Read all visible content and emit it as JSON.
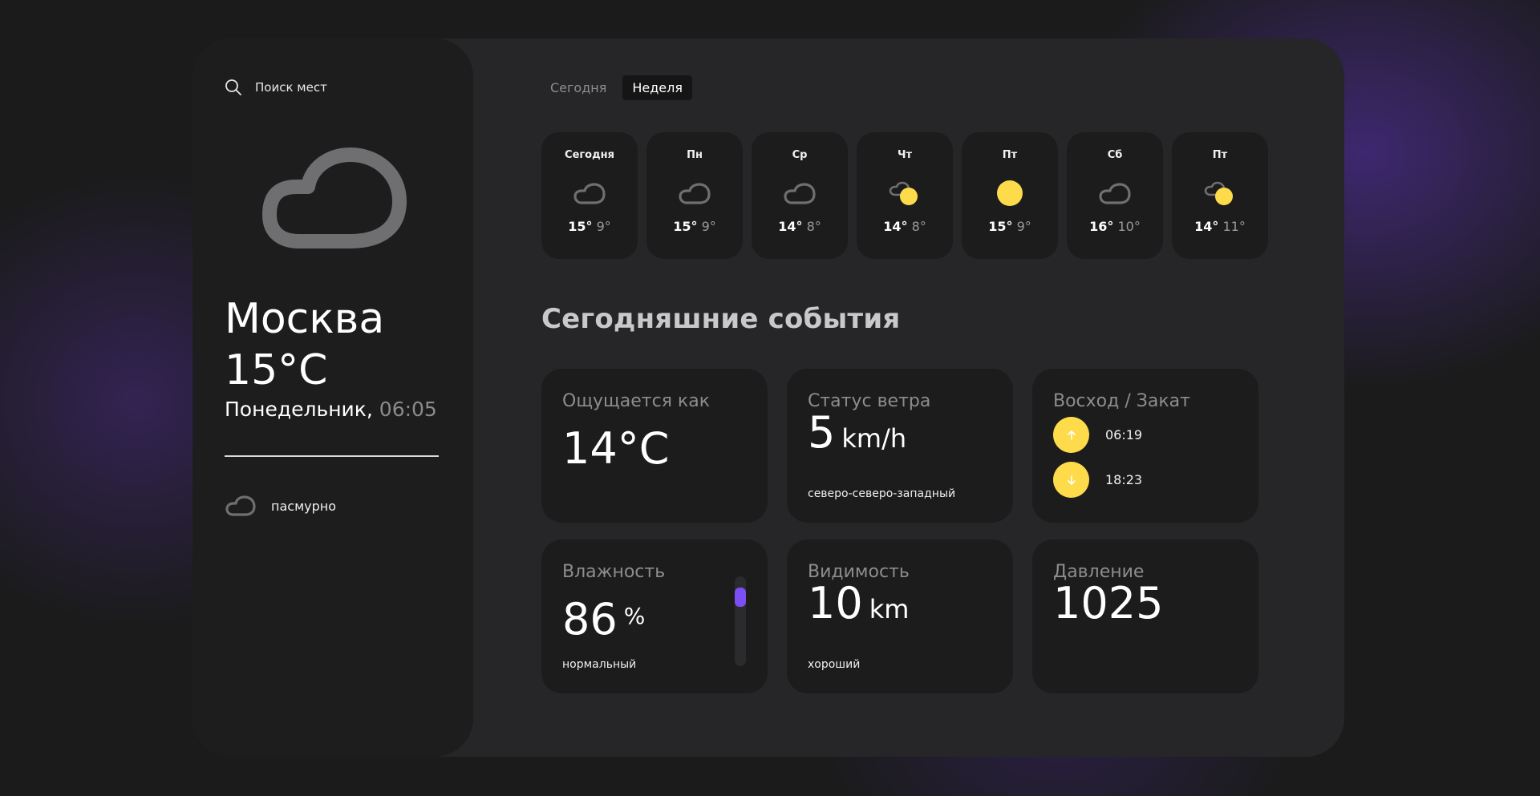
{
  "search": {
    "label": "Поиск мест"
  },
  "current": {
    "city": "Москва",
    "temperature": "15°C",
    "day": "Понедельник,",
    "time": "06:05",
    "condition": "пасмурно"
  },
  "tabs": [
    {
      "label": "Сегодня",
      "active": false
    },
    {
      "label": "Неделя",
      "active": true
    }
  ],
  "forecast": [
    {
      "day": "Сегодня",
      "icon": "cloud-icon",
      "high": "15°",
      "low": "9°"
    },
    {
      "day": "Пн",
      "icon": "cloud-icon",
      "high": "15°",
      "low": "9°"
    },
    {
      "day": "Ср",
      "icon": "cloud-icon",
      "high": "14°",
      "low": "8°"
    },
    {
      "day": "Чт",
      "icon": "sun-behind-cloud-icon",
      "high": "14°",
      "low": "8°"
    },
    {
      "day": "Пт",
      "icon": "sun-icon",
      "high": "15°",
      "low": "9°"
    },
    {
      "day": "Сб",
      "icon": "cloud-icon",
      "high": "16°",
      "low": "10°"
    },
    {
      "day": "Пт",
      "icon": "sun-behind-cloud-icon",
      "high": "14°",
      "low": "11°"
    }
  ],
  "section_title": "Сегодняшние события",
  "highlights": {
    "feels_like": {
      "title": "Ощущается как",
      "value": "14°C"
    },
    "wind": {
      "title": "Статус ветра",
      "value": "5",
      "unit": "km/h",
      "direction": "северо-северо-западный"
    },
    "sun": {
      "title": "Восход / Закат",
      "sunrise": "06:19",
      "sunset": "18:23"
    },
    "humidity": {
      "title": "Влажность",
      "value": "86",
      "unit": "%",
      "status": "нормальный",
      "level": 0.86
    },
    "visibility": {
      "title": "Видимость",
      "value": "10",
      "unit": "km",
      "status": "хороший"
    },
    "pressure": {
      "title": "Давление",
      "value": "1025"
    }
  },
  "colors": {
    "accent_yellow": "#fedb4a",
    "accent_purple": "#7b4ff3",
    "card": "#1c1c1d",
    "panel": "#262628",
    "muted_text": "#8d8d90"
  }
}
